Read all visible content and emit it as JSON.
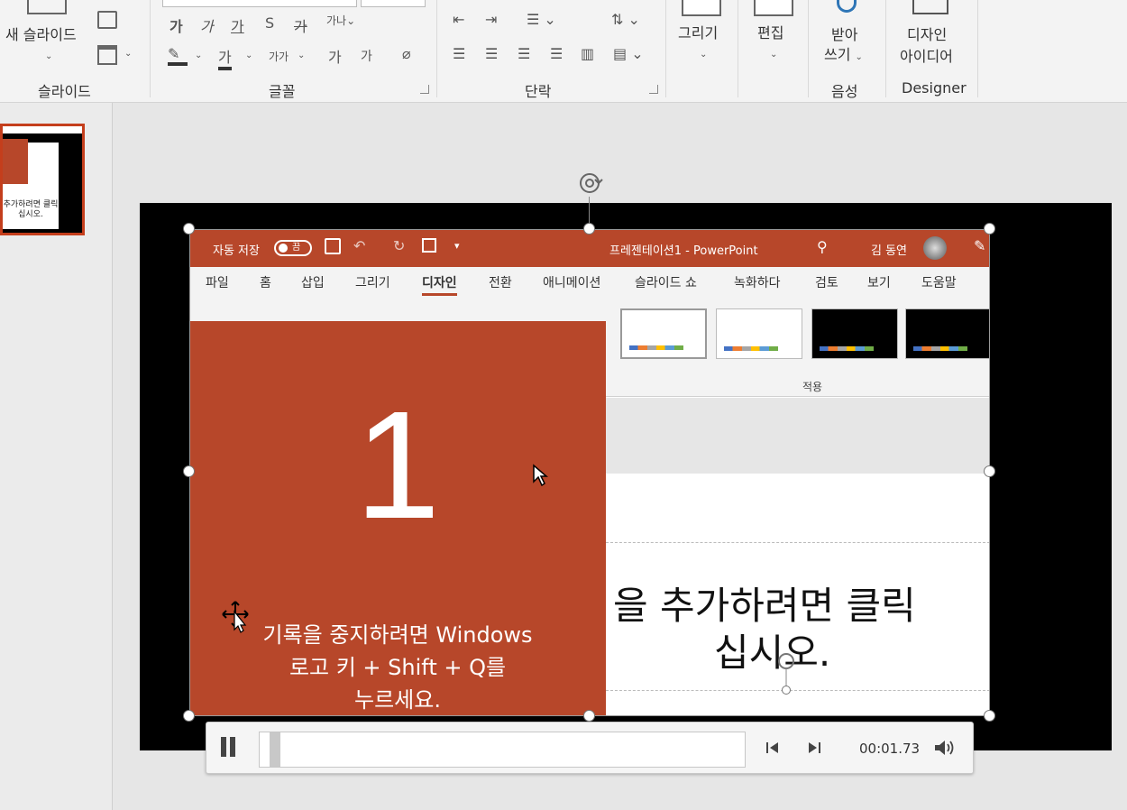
{
  "ribbon": {
    "new_slide_label": "새 슬라이드",
    "group_slides": "슬라이드",
    "group_font": "글꼴",
    "group_paragraph": "단락",
    "draw_label": "그리기",
    "edit_label": "편집",
    "dictate_line1": "받아",
    "dictate_line2": "쓰기",
    "group_voice": "음성",
    "designer_line1": "디자인",
    "designer_line2": "아이디어",
    "group_designer": "Designer",
    "font_row1": [
      "가",
      "가",
      "가",
      "S",
      "가"
    ],
    "font_row2": [
      "가",
      "가가",
      "가",
      "가"
    ]
  },
  "thumbnail": {
    "text_line1": "추가하려면 클릭",
    "text_line2": "십시오."
  },
  "inner_app": {
    "autosave_label": "자동 저장",
    "autosave_state": "끔",
    "doc_title": "프레젠테이션1  -  PowerPoint",
    "user_name": "김 동연",
    "tabs": [
      "파일",
      "홈",
      "삽입",
      "그리기",
      "디자인",
      "전환",
      "애니메이션",
      "슬라이드 쇼",
      "녹화하다",
      "검토",
      "보기",
      "도움말"
    ],
    "active_tab": "디자인",
    "gallery_label": "적용",
    "slide_text_line1": "을 추가하려면 클릭",
    "slide_text_line2": "십시오."
  },
  "recording_overlay": {
    "countdown": "1",
    "message_line1": "기록을 중지하려면 Windows",
    "message_line2": "로고 키 + Shift + Q를",
    "message_line3": "누르세요."
  },
  "playback": {
    "time": "00:01.73",
    "progress": 0.02
  },
  "colors": {
    "accent": "#b7472a",
    "selection": "#c43e1c"
  }
}
